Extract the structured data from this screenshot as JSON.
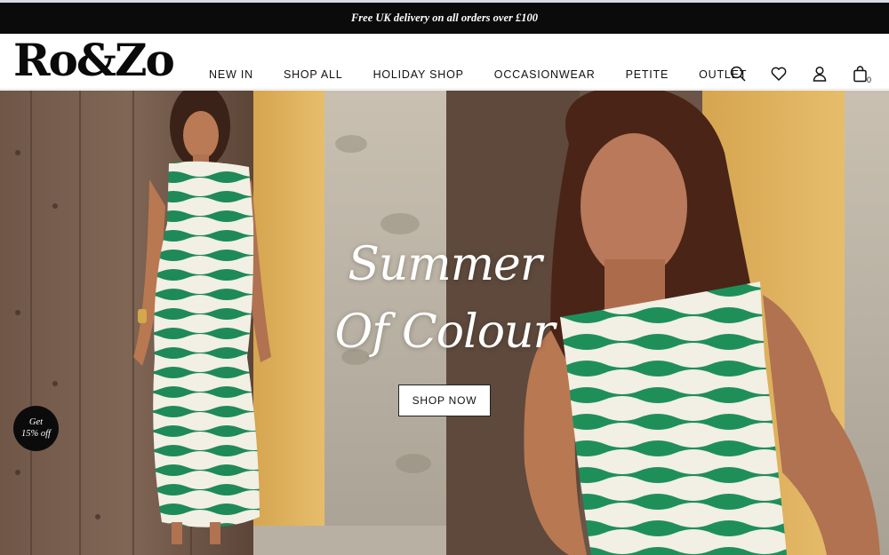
{
  "promo": {
    "text": "Free UK delivery on all orders over £100"
  },
  "brand": {
    "logo": "Ro&Zo"
  },
  "nav": {
    "items": [
      {
        "label": "NEW IN"
      },
      {
        "label": "SHOP ALL"
      },
      {
        "label": "HOLIDAY SHOP"
      },
      {
        "label": "OCCASIONWEAR"
      },
      {
        "label": "PETITE"
      },
      {
        "label": "OUTLET"
      }
    ]
  },
  "header_icons": {
    "search": "search-icon",
    "wishlist": "heart-icon",
    "account": "user-icon",
    "cart": "shopping-bag-icon",
    "cart_count": "0"
  },
  "hero": {
    "title_line1": "Summer",
    "title_line2": "Of Colour",
    "cta_label": "SHOP NOW"
  },
  "badge": {
    "line1": "Get",
    "line2": "15% off"
  },
  "colors": {
    "promo_bg": "#0b0b0b",
    "stripe_green": "#1e8a57",
    "stripe_cream": "#f2efe4",
    "wall_yellow": "#e0b05a"
  }
}
